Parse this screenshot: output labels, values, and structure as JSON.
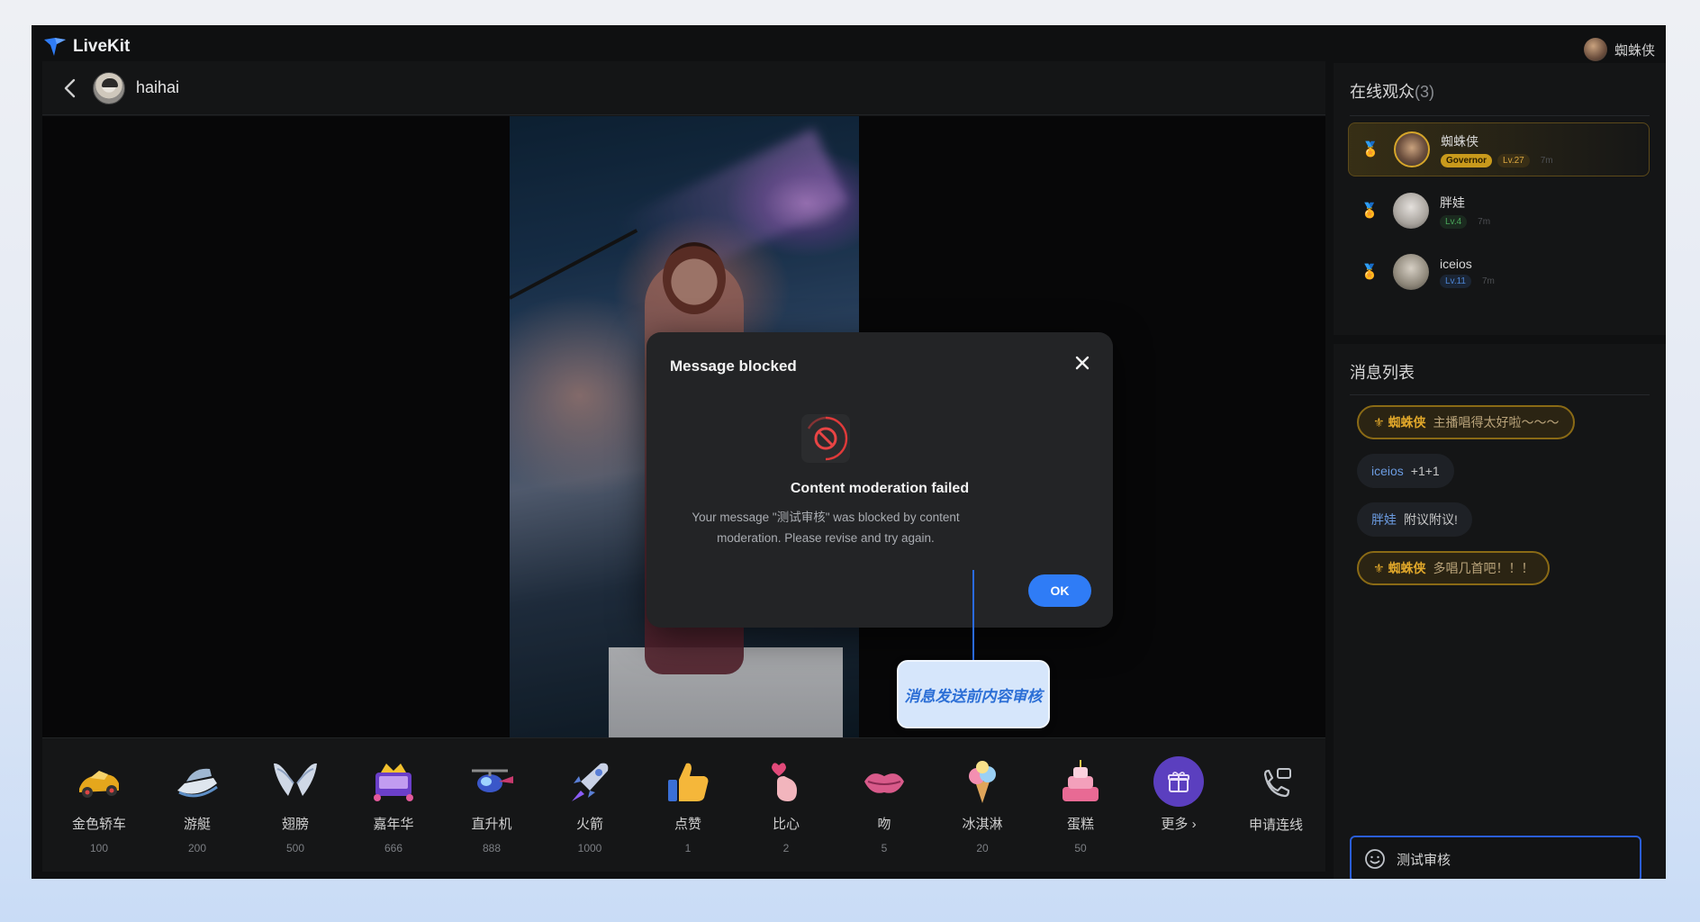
{
  "app": {
    "name": "LiveKit",
    "current_user": "蜘蛛侠"
  },
  "live": {
    "host_name": "haihai",
    "gifts": [
      {
        "name": "金色轿车",
        "price": "100",
        "icon": "gold-car-icon"
      },
      {
        "name": "游艇",
        "price": "200",
        "icon": "yacht-icon"
      },
      {
        "name": "翅膀",
        "price": "500",
        "icon": "wings-icon"
      },
      {
        "name": "嘉年华",
        "price": "666",
        "icon": "carnival-icon"
      },
      {
        "name": "直升机",
        "price": "888",
        "icon": "helicopter-icon"
      },
      {
        "name": "火箭",
        "price": "1000",
        "icon": "rocket-icon"
      },
      {
        "name": "点赞",
        "price": "1",
        "icon": "thumbs-up-icon"
      },
      {
        "name": "比心",
        "price": "2",
        "icon": "finger-heart-icon"
      },
      {
        "name": "吻",
        "price": "5",
        "icon": "kiss-icon"
      },
      {
        "name": "冰淇淋",
        "price": "20",
        "icon": "ice-cream-icon"
      },
      {
        "name": "蛋糕",
        "price": "50",
        "icon": "cake-icon"
      }
    ],
    "more_label": "更多",
    "connect_label": "申请连线"
  },
  "audience": {
    "title": "在线观众",
    "count": "(3)",
    "viewers": [
      {
        "name": "蜘蛛侠",
        "badge": "Governor",
        "level": "Lv.27",
        "time": "7m"
      },
      {
        "name": "胖娃",
        "level": "Lv.4",
        "time": "7m"
      },
      {
        "name": "iceios",
        "level": "Lv.11",
        "time": "7m"
      }
    ]
  },
  "messages": {
    "title": "消息列表",
    "items": [
      {
        "user": "蜘蛛侠",
        "text": "主播唱得太好啦～～～"
      },
      {
        "user": "iceios",
        "text": "+1+1"
      },
      {
        "user": "胖娃",
        "text": "附议附议!"
      },
      {
        "user": "蜘蛛侠",
        "text": "多唱几首吧！！！"
      }
    ],
    "input_value": "测试审核"
  },
  "modal": {
    "title": "Message blocked",
    "heading": "Content moderation failed",
    "body": "Your message \"测试审核\" was blocked by content moderation. Please revise and try again.",
    "ok_label": "OK"
  },
  "callout": {
    "text": "消息发送前内容审核"
  },
  "colors": {
    "accent": "#2f7cf6",
    "gold": "#c99a1c",
    "danger": "#e03a3a"
  }
}
